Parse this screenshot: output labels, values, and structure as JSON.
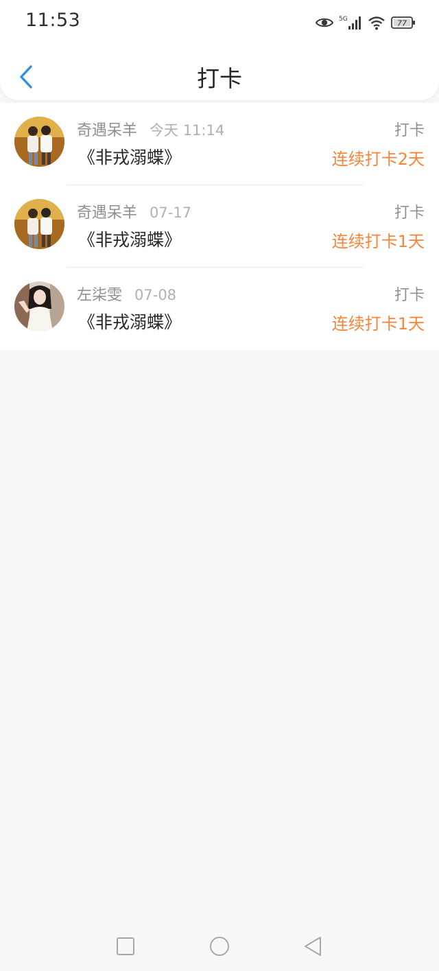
{
  "status_bar": {
    "time": "11:53",
    "network": "5G",
    "battery": "77"
  },
  "nav": {
    "title": "打卡"
  },
  "checkins": [
    {
      "user": "奇遇呆羊",
      "time": "今天 11:14",
      "book": "《非戎溺蝶》",
      "action": "打卡",
      "streak": "连续打卡2天",
      "avatar": "couple-photo"
    },
    {
      "user": "奇遇呆羊",
      "time": "07-17",
      "book": "《非戎溺蝶》",
      "action": "打卡",
      "streak": "连续打卡1天",
      "avatar": "couple-photo"
    },
    {
      "user": "左柒雯",
      "time": "07-08",
      "book": "《非戎溺蝶》",
      "action": "打卡",
      "streak": "连续打卡1天",
      "avatar": "girl-photo"
    }
  ],
  "colors": {
    "accent_orange": "#f5853a",
    "back_blue": "#2f8fe0",
    "page_bg": "#f8f6f7"
  }
}
